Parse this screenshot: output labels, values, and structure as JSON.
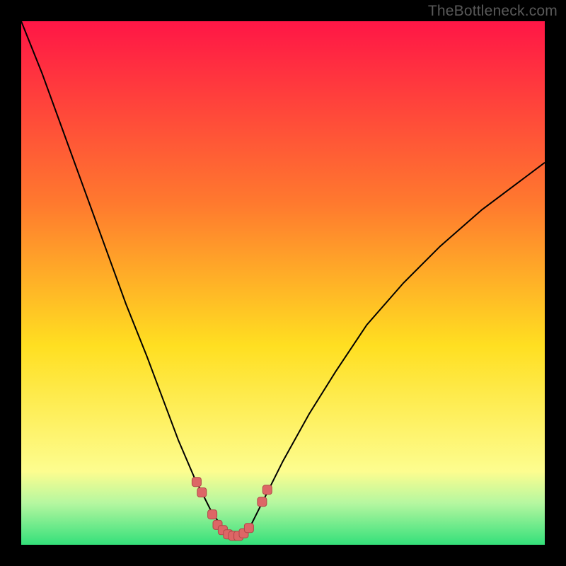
{
  "watermark": "TheBottleneck.com",
  "colors": {
    "bg_black": "#000000",
    "grad_top": "#ff1646",
    "grad_mid_upper": "#ff7a2e",
    "grad_mid": "#ffdf21",
    "grad_low": "#fdfd8f",
    "grad_bottom1": "#b6f7a0",
    "grad_bottom2": "#34e07a",
    "curve": "#000000",
    "marker_fill": "#dd6666",
    "marker_stroke": "#b04848"
  },
  "chart_data": {
    "type": "line",
    "title": "",
    "xlabel": "",
    "ylabel": "",
    "xlim": [
      0,
      100
    ],
    "ylim": [
      0,
      100
    ],
    "series": [
      {
        "name": "bottleneck-curve",
        "x": [
          0,
          4,
          8,
          12,
          16,
          20,
          24,
          27,
          30,
          33,
          35,
          36.5,
          38,
          39,
          40,
          41,
          42,
          43,
          44,
          46,
          50,
          55,
          60,
          66,
          73,
          80,
          88,
          96,
          100
        ],
        "y": [
          100,
          90,
          79,
          68,
          57,
          46,
          36,
          28,
          20,
          13,
          9,
          6,
          4,
          2.5,
          1.8,
          1.5,
          1.8,
          2.6,
          4,
          8,
          16,
          25,
          33,
          42,
          50,
          57,
          64,
          70,
          73
        ]
      }
    ],
    "markers": [
      {
        "x": 33.5,
        "y": 12
      },
      {
        "x": 34.5,
        "y": 10
      },
      {
        "x": 36.5,
        "y": 5.8
      },
      {
        "x": 37.5,
        "y": 3.8
      },
      {
        "x": 38.5,
        "y": 2.8
      },
      {
        "x": 39.5,
        "y": 2.0
      },
      {
        "x": 40.5,
        "y": 1.7
      },
      {
        "x": 41.5,
        "y": 1.7
      },
      {
        "x": 42.5,
        "y": 2.2
      },
      {
        "x": 43.5,
        "y": 3.2
      },
      {
        "x": 46.0,
        "y": 8.2
      },
      {
        "x": 47.0,
        "y": 10.5
      }
    ],
    "gradient_stops": [
      {
        "offset": 0.0,
        "key": "grad_top"
      },
      {
        "offset": 0.35,
        "key": "grad_mid_upper"
      },
      {
        "offset": 0.62,
        "key": "grad_mid"
      },
      {
        "offset": 0.86,
        "key": "grad_low"
      },
      {
        "offset": 0.92,
        "key": "grad_bottom1"
      },
      {
        "offset": 1.0,
        "key": "grad_bottom2"
      }
    ]
  }
}
